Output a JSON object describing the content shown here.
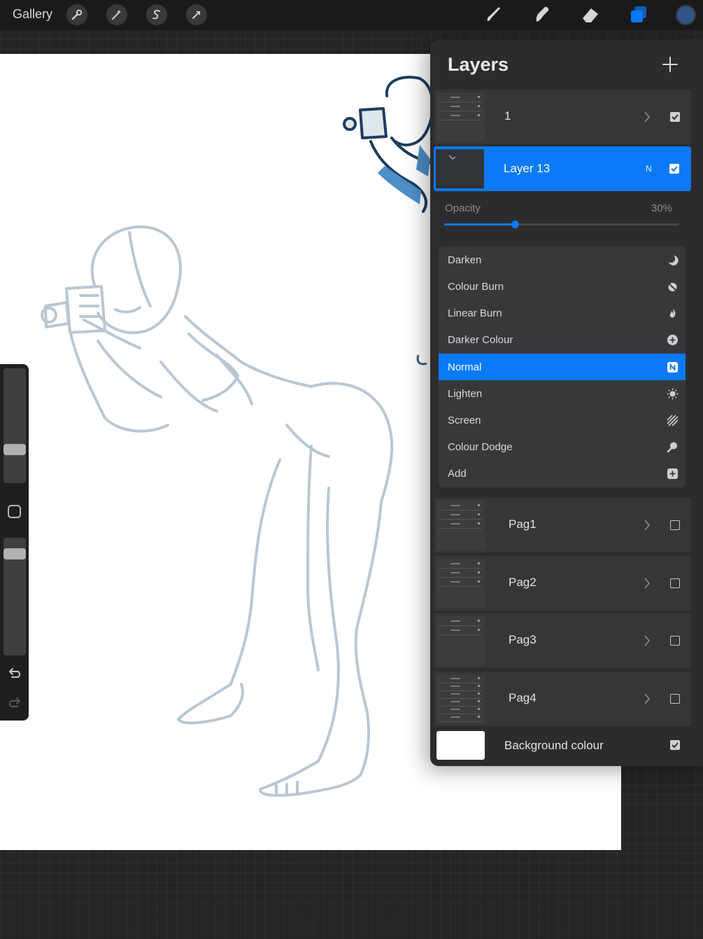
{
  "toolbar": {
    "gallery_label": "Gallery",
    "left_icons": [
      "wrench-icon",
      "magic-wand-icon",
      "selection-icon",
      "transform-arrow-icon"
    ],
    "right_icons": [
      "brush-icon",
      "smudge-icon",
      "eraser-icon",
      "layers-icon"
    ],
    "current_color": "#2f5589",
    "accent_color": "#0a7af8"
  },
  "layers_panel": {
    "title": "Layers",
    "add_label": "+",
    "opacity": {
      "label": "Opacity",
      "value_text": "30%",
      "value": 0.3
    },
    "layers": [
      {
        "name": "1",
        "type": "group",
        "visible": true
      },
      {
        "name": "Layer 13",
        "type": "layer",
        "blend_badge": "N",
        "visible": true,
        "active": true
      },
      {
        "name": "Pag1",
        "type": "group",
        "visible": false
      },
      {
        "name": "Pag2",
        "type": "group",
        "visible": false
      },
      {
        "name": "Pag3",
        "type": "group",
        "visible": false
      },
      {
        "name": "Pag4",
        "type": "group",
        "visible": false
      },
      {
        "name": "Background colour",
        "type": "background",
        "visible": true
      }
    ],
    "blend_modes": [
      {
        "label": "Darken",
        "icon": "moon-icon"
      },
      {
        "label": "Colour Burn",
        "icon": "burn-icon"
      },
      {
        "label": "Linear Burn",
        "icon": "flame-icon"
      },
      {
        "label": "Darker Colour",
        "icon": "plus-circle-icon"
      },
      {
        "label": "Normal",
        "icon": "n-badge-icon",
        "selected": true
      },
      {
        "label": "Lighten",
        "icon": "sun-icon"
      },
      {
        "label": "Screen",
        "icon": "hatch-icon"
      },
      {
        "label": "Colour Dodge",
        "icon": "dodge-icon"
      },
      {
        "label": "Add",
        "icon": "plus-square-icon"
      }
    ]
  },
  "sidebar": {
    "brush_size": 0.27,
    "brush_opacity": 0.9,
    "icons": [
      "modify-square-icon",
      "undo-icon",
      "redo-icon"
    ]
  }
}
